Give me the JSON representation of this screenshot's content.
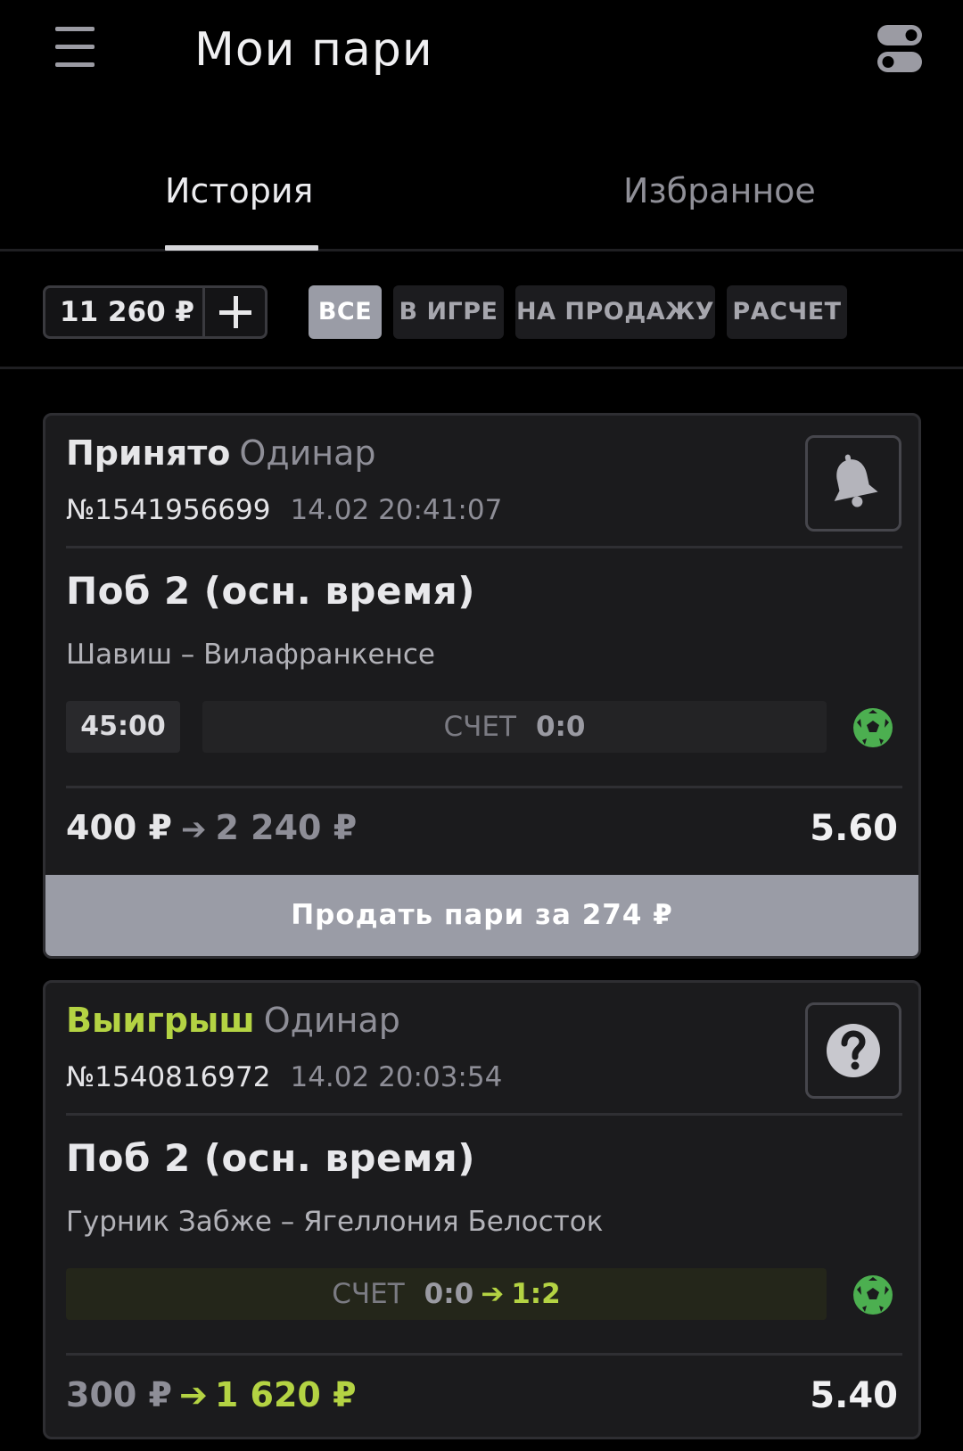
{
  "header": {
    "title": "Мои пари",
    "menu_icon": "hamburger-menu-icon",
    "toggle_icon": "toggle-switch-icon"
  },
  "tabs": [
    {
      "label": "История",
      "active": true
    },
    {
      "label": "Избранное",
      "active": false
    }
  ],
  "filters": {
    "balance": "11 260 ₽",
    "chips": [
      {
        "label": "ВСЕ",
        "active": true
      },
      {
        "label": "В ИГРЕ",
        "active": false
      },
      {
        "label": "НА ПРОДАЖУ",
        "active": false
      },
      {
        "label": "РАСЧЕТ",
        "active": false
      }
    ]
  },
  "bets": [
    {
      "status": "Принято",
      "type": "Одинар",
      "number": "№1541956699",
      "datetime": "14.02 20:41:07",
      "action_icon": "bell-icon",
      "market": "Поб 2 (осн. время)",
      "event": "Шавиш – Вилафранкенсе",
      "time": "45:00",
      "score_label": "СЧЕТ",
      "score": "0:0",
      "sport_icon": "soccer-ball-icon",
      "stake": "400 ₽",
      "payout": "2 240 ₽",
      "odds": "5.60",
      "sell_label": "Продать пари за 274 ₽"
    },
    {
      "status": "Выигрыш",
      "type": "Одинар",
      "number": "№1540816972",
      "datetime": "14.02 20:03:54",
      "action_icon": "question-icon",
      "market": "Поб 2 (осн. время)",
      "event": "Гурник Забже – Ягеллония Белосток",
      "score_label": "СЧЕТ",
      "score_initial": "0:0",
      "score_final": "1:2",
      "sport_icon": "soccer-ball-icon",
      "stake": "300 ₽",
      "payout": "1 620 ₽",
      "odds": "5.40"
    }
  ],
  "colors": {
    "background": "#000000",
    "card": "#1b1b1d",
    "accent_win": "#b4d343",
    "chip_active": "#9a9ca6",
    "soccer_icon": "#4caf50"
  }
}
